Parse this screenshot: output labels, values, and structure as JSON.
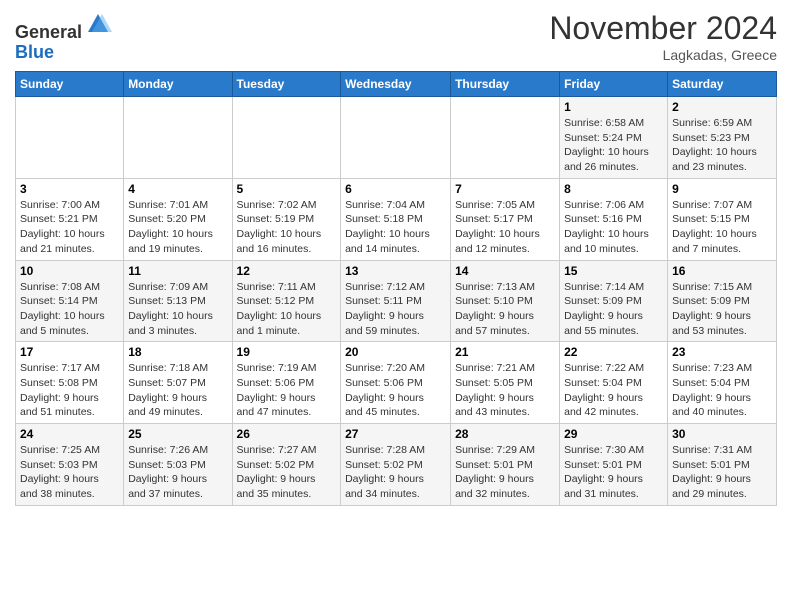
{
  "header": {
    "logo_line1": "General",
    "logo_line2": "Blue",
    "month": "November 2024",
    "location": "Lagkadas, Greece"
  },
  "weekdays": [
    "Sunday",
    "Monday",
    "Tuesday",
    "Wednesday",
    "Thursday",
    "Friday",
    "Saturday"
  ],
  "weeks": [
    [
      {
        "day": "",
        "info": ""
      },
      {
        "day": "",
        "info": ""
      },
      {
        "day": "",
        "info": ""
      },
      {
        "day": "",
        "info": ""
      },
      {
        "day": "",
        "info": ""
      },
      {
        "day": "1",
        "info": "Sunrise: 6:58 AM\nSunset: 5:24 PM\nDaylight: 10 hours\nand 26 minutes."
      },
      {
        "day": "2",
        "info": "Sunrise: 6:59 AM\nSunset: 5:23 PM\nDaylight: 10 hours\nand 23 minutes."
      }
    ],
    [
      {
        "day": "3",
        "info": "Sunrise: 7:00 AM\nSunset: 5:21 PM\nDaylight: 10 hours\nand 21 minutes."
      },
      {
        "day": "4",
        "info": "Sunrise: 7:01 AM\nSunset: 5:20 PM\nDaylight: 10 hours\nand 19 minutes."
      },
      {
        "day": "5",
        "info": "Sunrise: 7:02 AM\nSunset: 5:19 PM\nDaylight: 10 hours\nand 16 minutes."
      },
      {
        "day": "6",
        "info": "Sunrise: 7:04 AM\nSunset: 5:18 PM\nDaylight: 10 hours\nand 14 minutes."
      },
      {
        "day": "7",
        "info": "Sunrise: 7:05 AM\nSunset: 5:17 PM\nDaylight: 10 hours\nand 12 minutes."
      },
      {
        "day": "8",
        "info": "Sunrise: 7:06 AM\nSunset: 5:16 PM\nDaylight: 10 hours\nand 10 minutes."
      },
      {
        "day": "9",
        "info": "Sunrise: 7:07 AM\nSunset: 5:15 PM\nDaylight: 10 hours\nand 7 minutes."
      }
    ],
    [
      {
        "day": "10",
        "info": "Sunrise: 7:08 AM\nSunset: 5:14 PM\nDaylight: 10 hours\nand 5 minutes."
      },
      {
        "day": "11",
        "info": "Sunrise: 7:09 AM\nSunset: 5:13 PM\nDaylight: 10 hours\nand 3 minutes."
      },
      {
        "day": "12",
        "info": "Sunrise: 7:11 AM\nSunset: 5:12 PM\nDaylight: 10 hours\nand 1 minute."
      },
      {
        "day": "13",
        "info": "Sunrise: 7:12 AM\nSunset: 5:11 PM\nDaylight: 9 hours\nand 59 minutes."
      },
      {
        "day": "14",
        "info": "Sunrise: 7:13 AM\nSunset: 5:10 PM\nDaylight: 9 hours\nand 57 minutes."
      },
      {
        "day": "15",
        "info": "Sunrise: 7:14 AM\nSunset: 5:09 PM\nDaylight: 9 hours\nand 55 minutes."
      },
      {
        "day": "16",
        "info": "Sunrise: 7:15 AM\nSunset: 5:09 PM\nDaylight: 9 hours\nand 53 minutes."
      }
    ],
    [
      {
        "day": "17",
        "info": "Sunrise: 7:17 AM\nSunset: 5:08 PM\nDaylight: 9 hours\nand 51 minutes."
      },
      {
        "day": "18",
        "info": "Sunrise: 7:18 AM\nSunset: 5:07 PM\nDaylight: 9 hours\nand 49 minutes."
      },
      {
        "day": "19",
        "info": "Sunrise: 7:19 AM\nSunset: 5:06 PM\nDaylight: 9 hours\nand 47 minutes."
      },
      {
        "day": "20",
        "info": "Sunrise: 7:20 AM\nSunset: 5:06 PM\nDaylight: 9 hours\nand 45 minutes."
      },
      {
        "day": "21",
        "info": "Sunrise: 7:21 AM\nSunset: 5:05 PM\nDaylight: 9 hours\nand 43 minutes."
      },
      {
        "day": "22",
        "info": "Sunrise: 7:22 AM\nSunset: 5:04 PM\nDaylight: 9 hours\nand 42 minutes."
      },
      {
        "day": "23",
        "info": "Sunrise: 7:23 AM\nSunset: 5:04 PM\nDaylight: 9 hours\nand 40 minutes."
      }
    ],
    [
      {
        "day": "24",
        "info": "Sunrise: 7:25 AM\nSunset: 5:03 PM\nDaylight: 9 hours\nand 38 minutes."
      },
      {
        "day": "25",
        "info": "Sunrise: 7:26 AM\nSunset: 5:03 PM\nDaylight: 9 hours\nand 37 minutes."
      },
      {
        "day": "26",
        "info": "Sunrise: 7:27 AM\nSunset: 5:02 PM\nDaylight: 9 hours\nand 35 minutes."
      },
      {
        "day": "27",
        "info": "Sunrise: 7:28 AM\nSunset: 5:02 PM\nDaylight: 9 hours\nand 34 minutes."
      },
      {
        "day": "28",
        "info": "Sunrise: 7:29 AM\nSunset: 5:01 PM\nDaylight: 9 hours\nand 32 minutes."
      },
      {
        "day": "29",
        "info": "Sunrise: 7:30 AM\nSunset: 5:01 PM\nDaylight: 9 hours\nand 31 minutes."
      },
      {
        "day": "30",
        "info": "Sunrise: 7:31 AM\nSunset: 5:01 PM\nDaylight: 9 hours\nand 29 minutes."
      }
    ]
  ]
}
